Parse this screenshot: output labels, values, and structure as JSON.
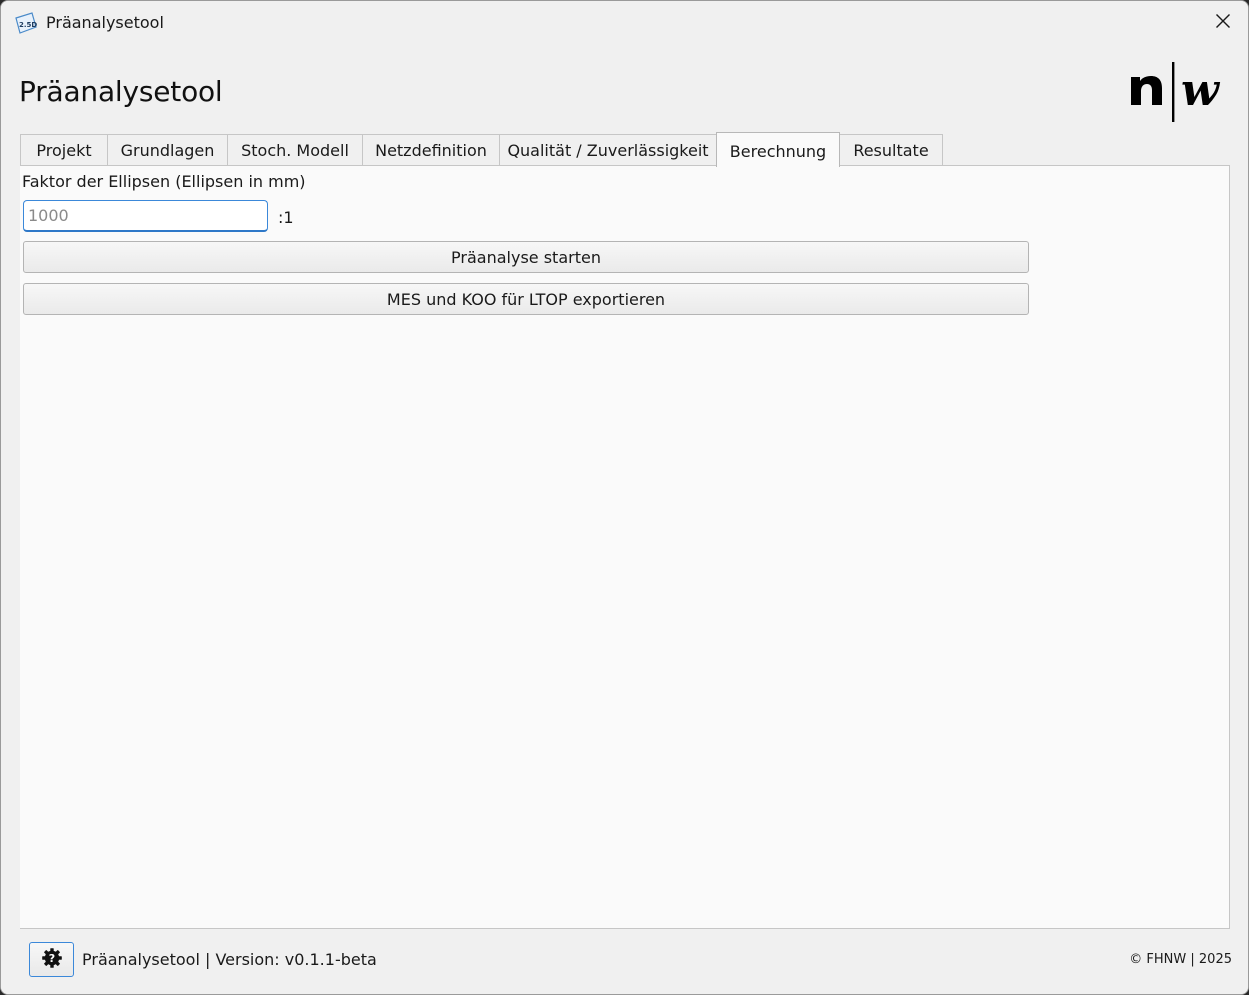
{
  "window": {
    "title": "Präanalysetool",
    "app_icon": "app-logo-icon",
    "close_icon": "close-icon"
  },
  "header": {
    "heading": "Präanalysetool",
    "logo": "fhnw-nw-logo"
  },
  "tabs": [
    {
      "label": "Projekt",
      "active": false
    },
    {
      "label": "Grundlagen",
      "active": false
    },
    {
      "label": "Stoch. Modell",
      "active": false
    },
    {
      "label": "Netzdefinition",
      "active": false
    },
    {
      "label": "Qualität / Zuverlässigkeit",
      "active": false
    },
    {
      "label": "Berechnung",
      "active": true
    },
    {
      "label": "Resultate",
      "active": false
    }
  ],
  "berechnung": {
    "ellipse_factor_label": "Faktor der Ellipsen (Ellipsen in mm)",
    "ellipse_factor_value": "",
    "ellipse_factor_placeholder": "1000",
    "ratio_suffix": ":1",
    "start_button": "Präanalyse starten",
    "export_button": "MES und KOO für LTOP exportieren"
  },
  "statusbar": {
    "settings_icon": "settings-help-icon",
    "version_text": "Präanalysetool | Version: v0.1.1-beta",
    "copyright": "© FHNW | 2025"
  },
  "colors": {
    "accent": "#3b88d9",
    "window_bg": "#f0f0f0",
    "panel_bg": "#fafafa"
  }
}
